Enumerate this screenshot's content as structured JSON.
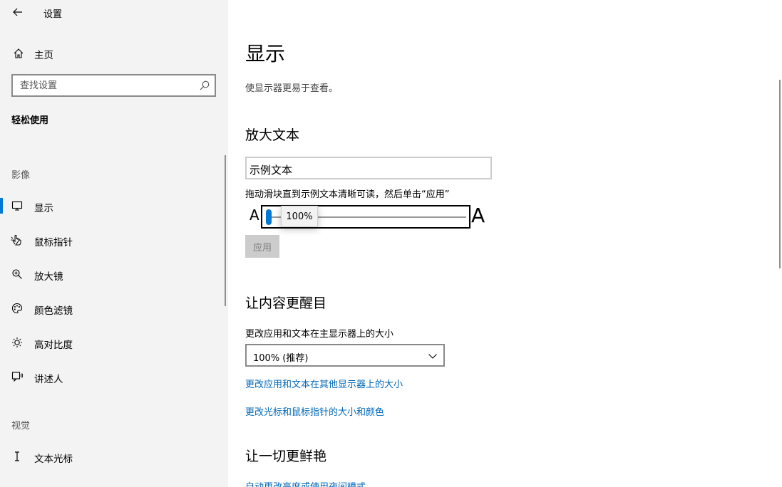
{
  "window": {
    "title": "设置"
  },
  "sidebar": {
    "home_label": "主页",
    "search_placeholder": "查找设置",
    "category": "轻松使用",
    "groups": [
      {
        "label": "影像"
      },
      {
        "label": "视觉"
      }
    ],
    "items": [
      {
        "label": "显示",
        "icon": "monitor-icon",
        "active": true
      },
      {
        "label": "鼠标指针",
        "icon": "pointer-hand-icon",
        "active": false
      },
      {
        "label": "放大镜",
        "icon": "magnifier-icon",
        "active": false
      },
      {
        "label": "颜色滤镜",
        "icon": "palette-icon",
        "active": false
      },
      {
        "label": "高对比度",
        "icon": "brightness-icon",
        "active": false
      },
      {
        "label": "讲述人",
        "icon": "narrator-icon",
        "active": false
      },
      {
        "label": "文本光标",
        "icon": "text-cursor-icon",
        "active": false
      }
    ]
  },
  "main": {
    "title": "显示",
    "description": "使显示器更易于查看。",
    "enlarge_text": {
      "heading": "放大文本",
      "sample_text": "示例文本",
      "hint": "拖动滑块直到示例文本清晰可读，然后单击“应用”",
      "small_a": "A",
      "large_a": "A",
      "slider_value": "100%",
      "slider_fraction": 0,
      "apply_label": "应用"
    },
    "make_bigger": {
      "heading": "让内容更醒目",
      "scale_label": "更改应用和文本在主显示器上的大小",
      "scale_value": "100% (推荐)",
      "link_other_displays": "更改应用和文本在其他显示器上的大小",
      "link_cursor": "更改光标和鼠标指针的大小和颜色"
    },
    "brighter": {
      "heading": "让一切更鲜艳",
      "link_brightness": "自动更改亮度或使用夜间模式"
    }
  },
  "colors": {
    "accent": "#0078d4",
    "link": "#0067b8",
    "sidebar_bg": "#f3f3f3"
  }
}
